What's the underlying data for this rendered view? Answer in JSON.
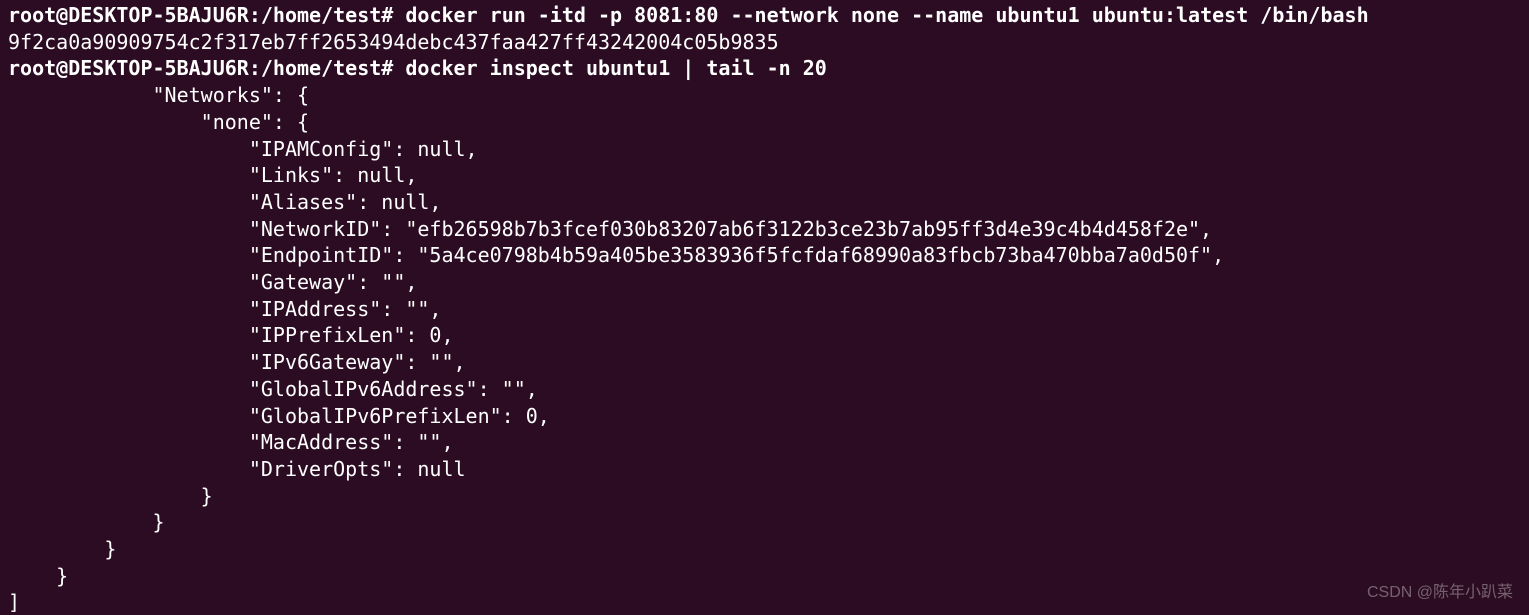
{
  "prompt1": "root@DESKTOP-5BAJU6R:/home/test# ",
  "command1": "docker run -itd -p 8081:80 --network none --name ubuntu1 ubuntu:latest /bin/bash",
  "output_container_id": "9f2ca0a90909754c2f317eb7ff2653494debc437faa427ff43242004c05b9835",
  "prompt2": "root@DESKTOP-5BAJU6R:/home/test# ",
  "command2": "docker inspect ubuntu1 | tail -n 20",
  "inspect_output": {
    "Networks": {
      "none": {
        "IPAMConfig": null,
        "Links": null,
        "Aliases": null,
        "NetworkID": "efb26598b7b3fcef030b83207ab6f3122b3ce23b7ab95ff3d4e39c4b4d458f2e",
        "EndpointID": "5a4ce0798b4b59a405be3583936f5fcfdaf68990a83fbcb73ba470bba7a0d50f",
        "Gateway": "",
        "IPAddress": "",
        "IPPrefixLen": 0,
        "IPv6Gateway": "",
        "GlobalIPv6Address": "",
        "GlobalIPv6PrefixLen": 0,
        "MacAddress": "",
        "DriverOpts": null
      }
    }
  },
  "lines": {
    "l0": "            \"Networks\": {",
    "l1": "                \"none\": {",
    "l2": "                    \"IPAMConfig\": null,",
    "l3": "                    \"Links\": null,",
    "l4": "                    \"Aliases\": null,",
    "l5": "                    \"NetworkID\": \"efb26598b7b3fcef030b83207ab6f3122b3ce23b7ab95ff3d4e39c4b4d458f2e\",",
    "l6": "                    \"EndpointID\": \"5a4ce0798b4b59a405be3583936f5fcfdaf68990a83fbcb73ba470bba7a0d50f\",",
    "l7": "                    \"Gateway\": \"\",",
    "l8": "                    \"IPAddress\": \"\",",
    "l9": "                    \"IPPrefixLen\": 0,",
    "l10": "                    \"IPv6Gateway\": \"\",",
    "l11": "                    \"GlobalIPv6Address\": \"\",",
    "l12": "                    \"GlobalIPv6PrefixLen\": 0,",
    "l13": "                    \"MacAddress\": \"\",",
    "l14": "                    \"DriverOpts\": null",
    "l15": "                }",
    "l16": "            }",
    "l17": "        }",
    "l18": "    }",
    "l19": "]"
  },
  "watermark": "CSDN @陈年小趴菜"
}
